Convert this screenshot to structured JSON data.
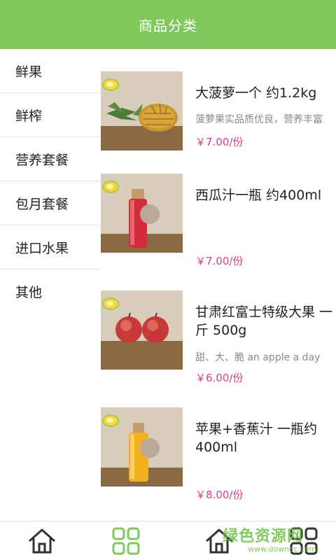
{
  "header": {
    "title": "商品分类"
  },
  "sidebar": {
    "items": [
      {
        "label": "鲜果"
      },
      {
        "label": "鲜榨"
      },
      {
        "label": "营养套餐"
      },
      {
        "label": "包月套餐"
      },
      {
        "label": "进口水果"
      },
      {
        "label": "其他"
      }
    ]
  },
  "products": [
    {
      "name": "大菠萝一个 约1.2kg",
      "desc": "菠萝果实品质优良，营养丰富",
      "price": "￥7.00/份"
    },
    {
      "name": "西瓜汁一瓶 约400ml",
      "desc": "",
      "price": "￥7.00/份"
    },
    {
      "name": "甘肃红富士特级大果 一斤 500g",
      "desc": "甜、大、脆 an apple a day",
      "price": "￥6.00/份"
    },
    {
      "name": "苹果+香蕉汁 一瓶约400ml",
      "desc": "",
      "price": "￥8.00/份"
    }
  ],
  "watermark": {
    "main": "绿色资源网",
    "sub": "www.downcc.com"
  },
  "icons": {
    "tab1": "home-icon",
    "tab2": "grid-icon",
    "tab3": "home-icon",
    "tab4": "grid-icon"
  },
  "colors": {
    "header": "#7ec85c",
    "price": "#e0398a",
    "accent": "#7ec85c"
  }
}
